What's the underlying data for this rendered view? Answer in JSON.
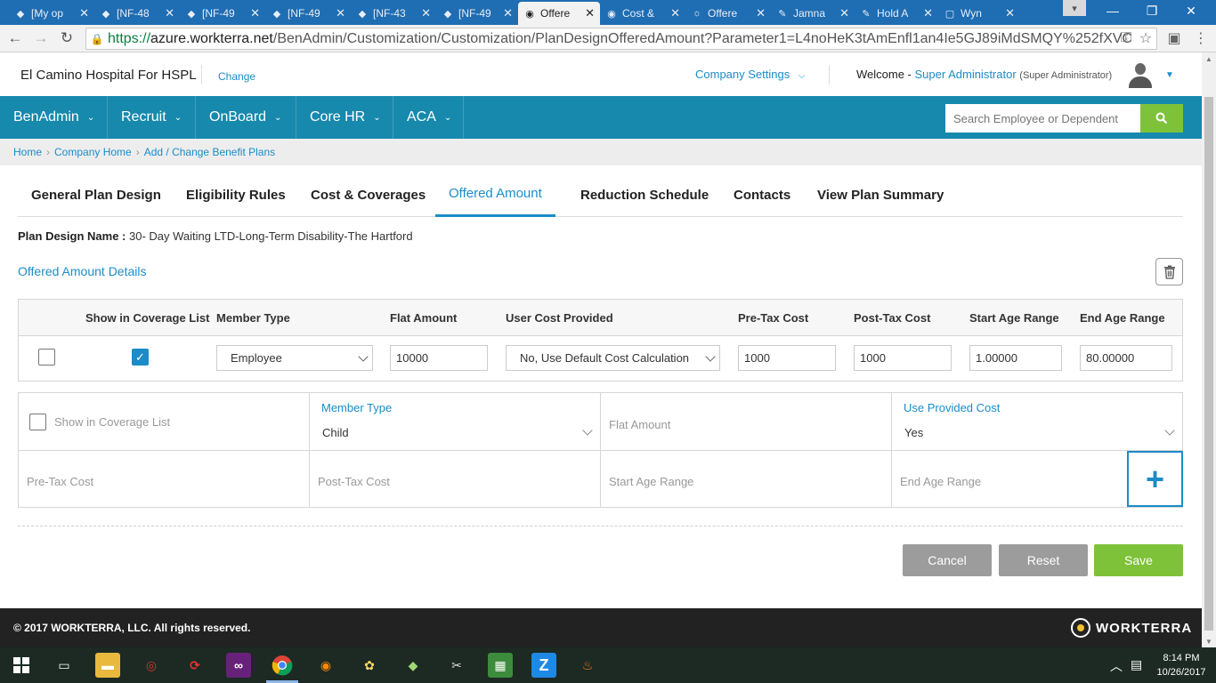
{
  "browser": {
    "tabs": [
      {
        "label": "[My op",
        "icon": "diamond-icon"
      },
      {
        "label": "[NF-48",
        "icon": "diamond-icon"
      },
      {
        "label": "[NF-49",
        "icon": "diamond-icon"
      },
      {
        "label": "[NF-49",
        "icon": "diamond-icon"
      },
      {
        "label": "[NF-43",
        "icon": "diamond-icon"
      },
      {
        "label": "[NF-49",
        "icon": "diamond-icon"
      },
      {
        "label": "Offere",
        "icon": "globe-icon"
      },
      {
        "label": "Cost &",
        "icon": "globe-icon"
      },
      {
        "label": "Offere",
        "icon": "sun-icon"
      },
      {
        "label": "Jamna",
        "icon": "edit-icon"
      },
      {
        "label": "Hold A",
        "icon": "edit-icon"
      },
      {
        "label": "Wyn",
        "icon": "doc-icon"
      }
    ],
    "url_scheme": "https://",
    "url_host": "azure.workterra.net",
    "url_path": "/BenAdmin/Customization/Customization/PlanDesignOfferedAmount?Parameter1=L4noHeK3tAmEnfl1an4Ie5GJ89iMdSMQY%252fXVC"
  },
  "header": {
    "company": "El Camino Hospital For HSPL",
    "change": "Change",
    "company_settings": "Company Settings",
    "welcome": "Welcome - ",
    "user_name": "Super Administrator",
    "user_role": "(Super Administrator)"
  },
  "nav": {
    "items": [
      "BenAdmin",
      "Recruit",
      "OnBoard",
      "Core HR",
      "ACA"
    ],
    "search_placeholder": "Search Employee or Dependent"
  },
  "breadcrumb": [
    "Home",
    "Company Home",
    "Add / Change Benefit Plans"
  ],
  "tabs": [
    "General Plan Design",
    "Eligibility Rules",
    "Cost & Coverages",
    "Offered Amount",
    "Reduction Schedule",
    "Contacts",
    "View Plan Summary"
  ],
  "plan": {
    "label": "Plan Design Name :",
    "name": "30- Day Waiting LTD-Long-Term Disability-The Hartford"
  },
  "section_title": "Offered Amount Details",
  "table": {
    "columns": [
      "Show in Coverage List",
      "Member Type",
      "Flat Amount",
      "User Cost Provided",
      "Pre-Tax Cost",
      "Post-Tax Cost",
      "Start Age Range",
      "End Age Range"
    ],
    "rows": [
      {
        "selected": false,
        "show_in_coverage": true,
        "member_type": "Employee",
        "flat_amount": "10000",
        "user_cost_provided": "No, Use Default Cost Calculation",
        "pre_tax_cost": "1000",
        "post_tax_cost": "1000",
        "start_age": "1.00000",
        "end_age": "80.00000"
      }
    ]
  },
  "add_form": {
    "show_in_coverage_label": "Show in Coverage List",
    "member_type_label": "Member Type",
    "member_type_value": "Child",
    "flat_amount_placeholder": "Flat Amount",
    "use_provided_cost_label": "Use Provided Cost",
    "use_provided_cost_value": "Yes",
    "pre_tax_placeholder": "Pre-Tax Cost",
    "post_tax_placeholder": "Post-Tax Cost",
    "start_age_placeholder": "Start Age Range",
    "end_age_placeholder": "End Age Range"
  },
  "actions": {
    "cancel": "Cancel",
    "reset": "Reset",
    "save": "Save"
  },
  "footer": {
    "copyright": "© 2017 WORKTERRA, LLC. All rights reserved.",
    "brand": "WORKTERRA"
  },
  "taskbar": {
    "time": "8:14 PM",
    "date": "10/26/2017"
  },
  "colors": {
    "accent": "#1789ad",
    "link": "#1b8cc8",
    "save": "#7ec23a",
    "grey_button": "#9c9c9c"
  }
}
